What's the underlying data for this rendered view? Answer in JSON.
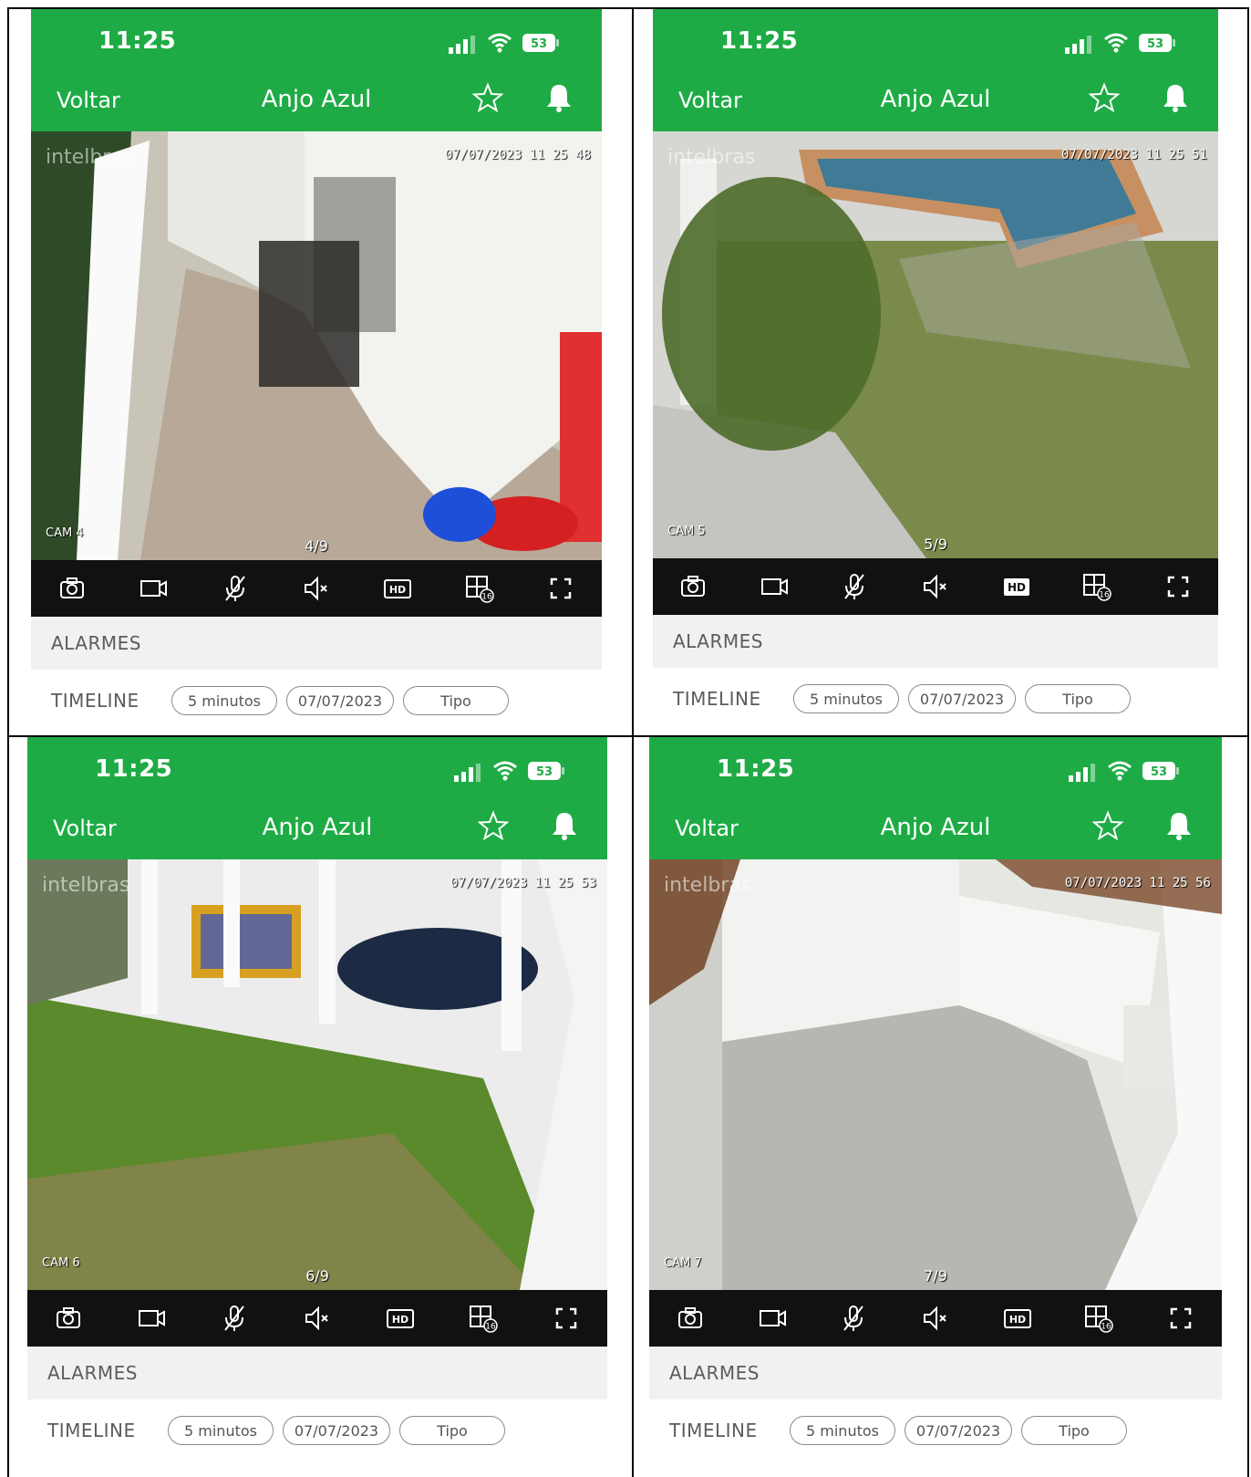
{
  "status": {
    "time": "11:25",
    "battery": "53"
  },
  "nav": {
    "back_label": "Voltar",
    "title": "Anjo Azul"
  },
  "watermark": "intelbras",
  "alarms_label": "ALARMES",
  "timeline": {
    "label": "TIMELINE",
    "range": "5 minutos",
    "date": "07/07/2023",
    "type": "Tipo"
  },
  "toolbar_icons": [
    "camera-icon",
    "video-record-icon",
    "mic-off-icon",
    "speaker-mute-icon",
    "hd-icon",
    "grid-16-icon",
    "fullscreen-icon"
  ],
  "colors": {
    "accent": "#1eab45",
    "toolbar": "#111111",
    "alarms_bg": "#f1f1f1"
  },
  "panels": [
    {
      "timestamp": "07/07/2023 11 25 48",
      "cam": "CAM 4",
      "counter": "4/9",
      "hd_active": false
    },
    {
      "timestamp": "07/07/2023 11 25 51",
      "cam": "CAM 5",
      "counter": "5/9",
      "hd_active": true
    },
    {
      "timestamp": "07/07/2023 11 25 53",
      "cam": "CAM 6",
      "counter": "6/9",
      "hd_active": false
    },
    {
      "timestamp": "07/07/2023 11 25 56",
      "cam": "CAM 7",
      "counter": "7/9",
      "hd_active": false
    }
  ]
}
